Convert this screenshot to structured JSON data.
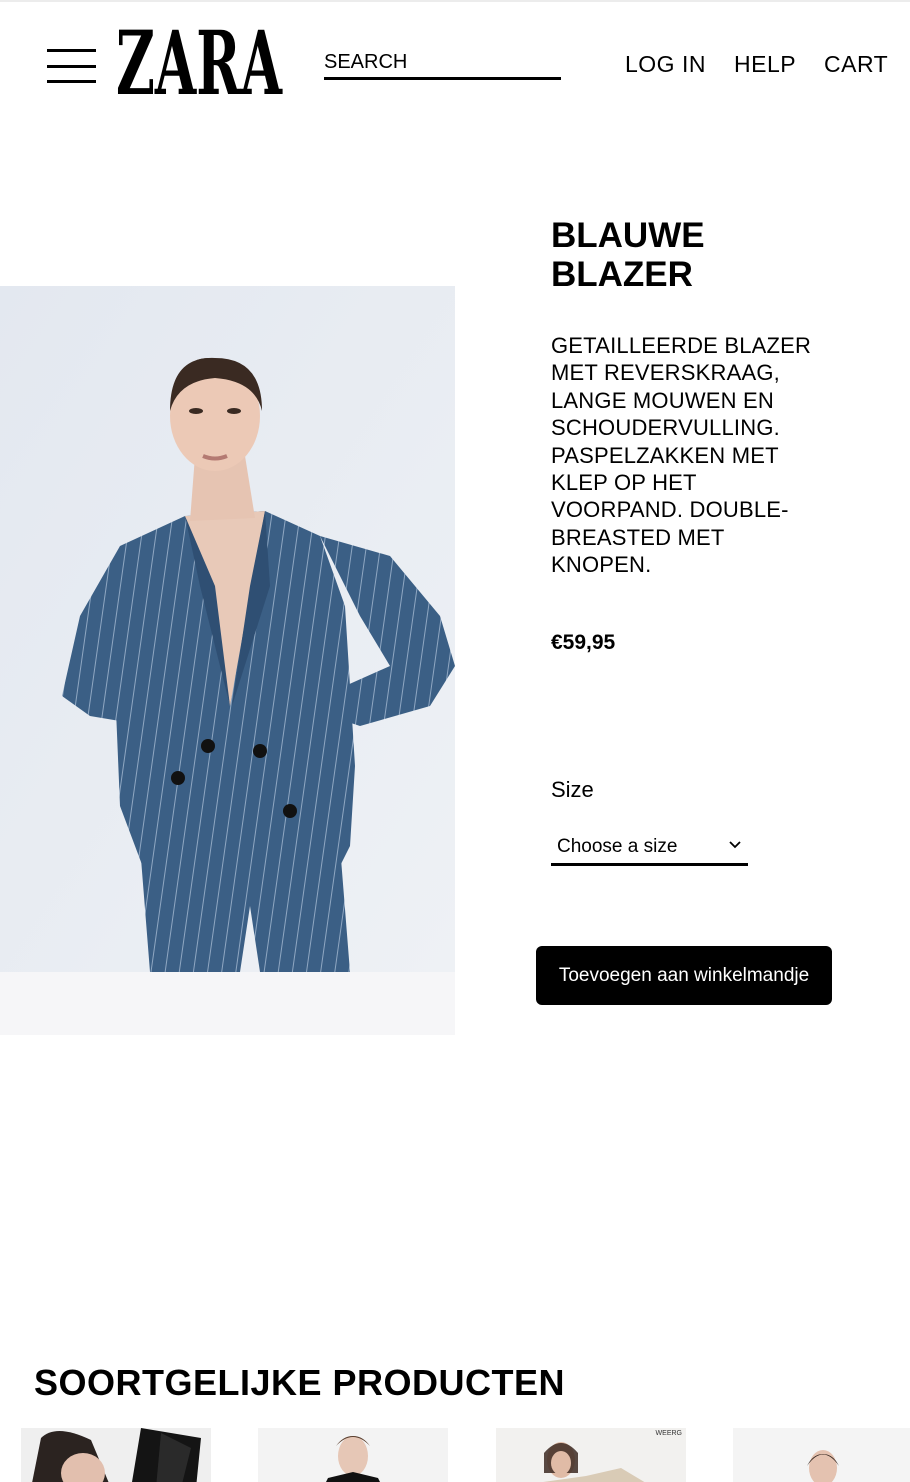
{
  "header": {
    "logo": "ZARA",
    "search_placeholder": "SEARCH",
    "nav": {
      "login": "LOG IN",
      "help": "HELP",
      "cart": "CART"
    }
  },
  "product": {
    "title": "BLAUWE BLAZER",
    "description": "GETAILLEERDE BLAZER MET REVERSKRAAG, LANGE MOUWEN EN SCHOUDERVULLING. PASPELZAKKEN MET KLEP OP HET VOORPAND. DOUBLE-BREASTED MET KNOPEN.",
    "price": "€59,95",
    "size_label": "Size",
    "size_select_value": "Choose a size",
    "add_to_cart_label": "Toevoegen aan winkelmandje",
    "image_icon": "model-in-blue-pinstripe-blazer",
    "colors": {
      "blazer": "#3b5f85",
      "background": "#e9edf3"
    }
  },
  "similar": {
    "title": "SOORTGELIJKE PRODUCTEN",
    "items": [
      {
        "icon": "model-black-jacket-thumbnail",
        "tag": ""
      },
      {
        "icon": "model-dark-blazer-thumbnail",
        "tag": ""
      },
      {
        "icon": "model-beige-coat-thumbnail",
        "tag": "WEERG"
      },
      {
        "icon": "model-thumbnail",
        "tag": ""
      }
    ]
  }
}
